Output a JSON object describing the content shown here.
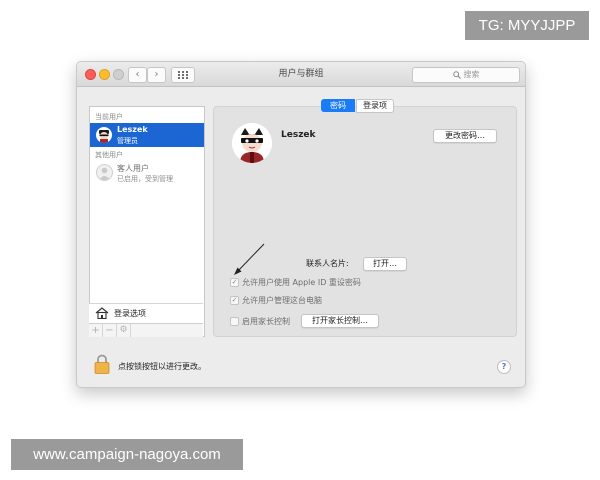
{
  "watermarks": {
    "top": "TG: MYYJJPP",
    "bottom": "www.campaign-nagoya.com"
  },
  "window": {
    "title": "用户与群组",
    "search_placeholder": "搜索",
    "nav": {
      "back": "‹",
      "forward": "›"
    }
  },
  "sidebar": {
    "current_users_label": "当前用户",
    "current_user": {
      "name": "Leszek",
      "role": "管理员"
    },
    "other_users_label": "其他用户",
    "guest": {
      "name": "客人用户",
      "status": "已启用，受到管理"
    },
    "login_options_label": "登录选项",
    "tools": {
      "add": "+",
      "remove": "−",
      "gear": "⚙"
    }
  },
  "tabs": [
    {
      "label": "密码",
      "active": true
    },
    {
      "label": "登录项",
      "active": false
    }
  ],
  "main": {
    "user_name": "Leszek",
    "change_password_button": "更改密码…",
    "contact_card_label": "联系人名片:",
    "open_button": "打开…",
    "options": [
      {
        "label": "允许用户使用 Apple ID 重设密码",
        "checked": true
      },
      {
        "label": "允许用户管理这台电脑",
        "checked": true
      },
      {
        "label": "启用家长控制",
        "checked": false
      }
    ],
    "open_parental_button": "打开家长控制…"
  },
  "footer": {
    "lock_text": "点按锁按钮以进行更改。",
    "help": "?"
  },
  "colors": {
    "selection": "#1b66d3",
    "segment_active": "#1b7cf6",
    "close": "#fc5f57",
    "minimize": "#fdbc2e"
  }
}
